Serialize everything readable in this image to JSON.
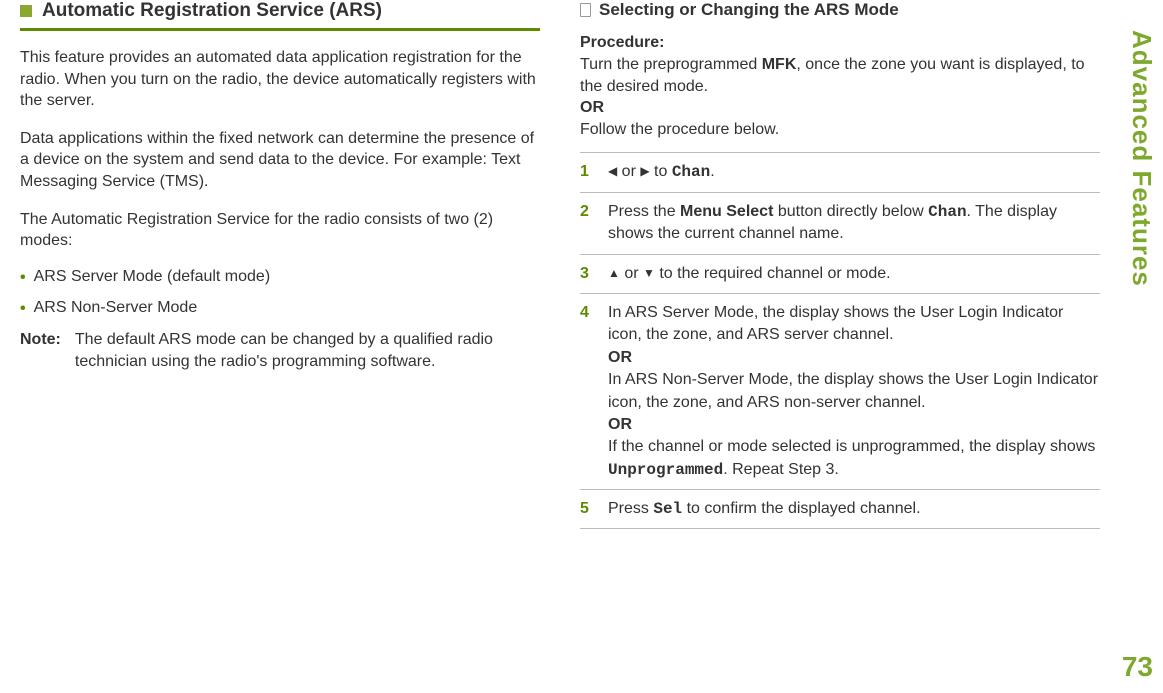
{
  "side_title": "Advanced Features",
  "page_number": "73",
  "left": {
    "section_title": "Automatic Registration Service (ARS)",
    "para1": "This feature provides an automated data application registration for the radio. When you turn on the radio, the device automatically registers with the server.",
    "para2": "Data applications within the fixed network can determine the presence of a device on the system and send data to the device. For example: Text Messaging Service (TMS).",
    "para3": "The Automatic Registration Service for the radio consists of two (2) modes:",
    "bullet1": "ARS Server Mode (default mode)",
    "bullet2": "ARS Non-Server Mode",
    "note_label": "Note:",
    "note_text": "The default ARS mode can be changed by a qualified radio technician using the radio's programming software."
  },
  "right": {
    "sub_title": "Selecting or Changing the ARS Mode",
    "procedure_label": "Procedure:",
    "proc_line1a": "Turn the preprogrammed ",
    "proc_mfk": "MFK",
    "proc_line1b": ", once the zone you want is displayed, to the desired mode.",
    "or": "OR",
    "proc_line2": "Follow the procedure below.",
    "steps": {
      "s1_pre": "",
      "s1_or": " or ",
      "s1_to": " to ",
      "s1_chan": "Chan",
      "s1_period": ".",
      "s2_a": "Press the ",
      "s2_menu": "Menu Select",
      "s2_b": " button directly below ",
      "s2_chan": "Chan",
      "s2_c": ". The display shows the current channel name.",
      "s3_or": " or ",
      "s3_text": " to the required channel or mode.",
      "s4_a": "In ARS Server Mode, the display shows the User Login Indicator icon, the zone, and ARS server channel.",
      "s4_or1": "OR",
      "s4_b": "In ARS Non-Server Mode, the display shows the User Login Indicator icon, the zone, and ARS non-server channel.",
      "s4_or2": "OR",
      "s4_c1": "If the channel or mode selected is unprogrammed, the display shows ",
      "s4_unprog": "Unprogrammed",
      "s4_c2": ". Repeat Step 3.",
      "s5_a": "Press ",
      "s5_sel": "Sel",
      "s5_b": " to confirm the displayed channel."
    }
  }
}
